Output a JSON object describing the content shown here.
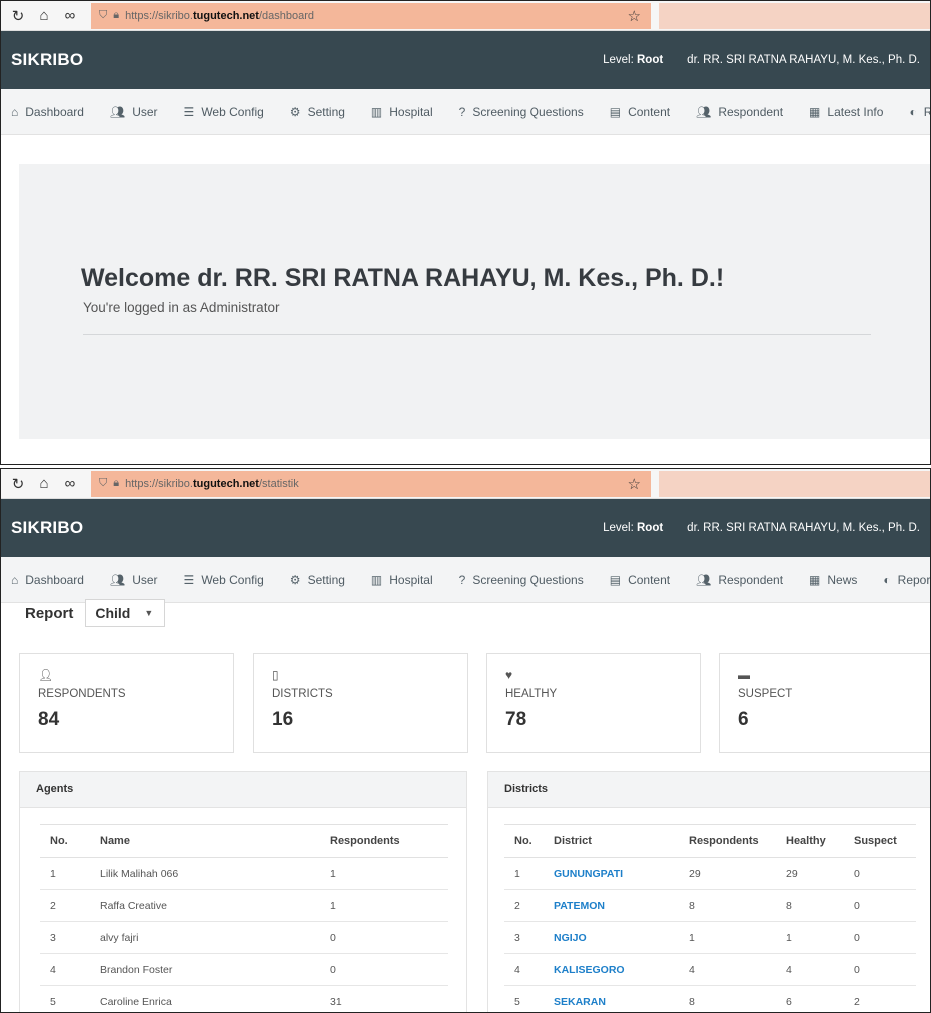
{
  "screen1": {
    "browser": {
      "url_prefix": "https://sikribo.",
      "url_host": "tugutech.net",
      "url_path": "/dashboard"
    },
    "header": {
      "brand": "SIKRIBO",
      "level_label": "Level: ",
      "level_value": "Root",
      "user_name": "dr. RR. SRI RATNA RAHAYU, M. Kes., Ph. D."
    },
    "nav": [
      {
        "icon": "home-icon",
        "label": "Dashboard"
      },
      {
        "icon": "users-icon",
        "label": "User"
      },
      {
        "icon": "database-icon",
        "label": "Web Config"
      },
      {
        "icon": "cogs-icon",
        "label": "Setting"
      },
      {
        "icon": "hospital-icon",
        "label": "Hospital"
      },
      {
        "icon": "question-icon",
        "label": "Screening Questions"
      },
      {
        "icon": "content-icon",
        "label": "Content"
      },
      {
        "icon": "users-icon",
        "label": "Respondent"
      },
      {
        "icon": "newspaper-icon",
        "label": "Latest Info"
      },
      {
        "icon": "dashboard-gauge-icon",
        "label": "Report"
      }
    ],
    "welcome": {
      "title": "Welcome dr. RR. SRI RATNA RAHAYU, M. Kes., Ph. D.!",
      "subtitle": "You're logged in as Administrator"
    }
  },
  "screen2": {
    "browser": {
      "url_prefix": "https://sikribo.",
      "url_host": "tugutech.net",
      "url_path": "/statistik"
    },
    "header": {
      "brand": "SIKRIBO",
      "level_label": "Level: ",
      "level_value": "Root",
      "user_name": "dr. RR. SRI RATNA RAHAYU, M. Kes., Ph. D."
    },
    "nav": [
      {
        "icon": "home-icon",
        "label": "Dashboard"
      },
      {
        "icon": "users-icon",
        "label": "User"
      },
      {
        "icon": "database-icon",
        "label": "Web Config"
      },
      {
        "icon": "cogs-icon",
        "label": "Setting"
      },
      {
        "icon": "hospital-icon",
        "label": "Hospital"
      },
      {
        "icon": "question-icon",
        "label": "Screening Questions"
      },
      {
        "icon": "content-icon",
        "label": "Content"
      },
      {
        "icon": "users-icon",
        "label": "Respondent"
      },
      {
        "icon": "newspaper-icon",
        "label": "News"
      },
      {
        "icon": "dashboard-gauge-icon",
        "label": "Report"
      }
    ],
    "report": {
      "label": "Report",
      "selected": "Child"
    },
    "stats": [
      {
        "icon": "user-check-icon",
        "label": "RESPONDENTS",
        "value": "84"
      },
      {
        "icon": "map-icon",
        "label": "DISTRICTS",
        "value": "16"
      },
      {
        "icon": "heartbeat-icon",
        "label": "HEALTHY",
        "value": "78"
      },
      {
        "icon": "bed-icon",
        "label": "SUSPECT",
        "value": "6"
      }
    ],
    "agents": {
      "title": "Agents",
      "headers": [
        "No.",
        "Name",
        "Respondents"
      ],
      "rows": [
        [
          "1",
          "Lilik Malihah 066",
          "1"
        ],
        [
          "2",
          "Raffa Creative",
          "1"
        ],
        [
          "3",
          "alvy fajri",
          "0"
        ],
        [
          "4",
          "Brandon Foster",
          "0"
        ],
        [
          "5",
          "Caroline Enrica",
          "31"
        ]
      ]
    },
    "districts": {
      "title": "Districts",
      "headers": [
        "No.",
        "District",
        "Respondents",
        "Healthy",
        "Suspect"
      ],
      "rows": [
        [
          "1",
          "GUNUNGPATI",
          "29",
          "29",
          "0"
        ],
        [
          "2",
          "PATEMON",
          "8",
          "8",
          "0"
        ],
        [
          "3",
          "NGIJO",
          "1",
          "1",
          "0"
        ],
        [
          "4",
          "KALISEGORO",
          "4",
          "4",
          "0"
        ],
        [
          "5",
          "SEKARAN",
          "8",
          "6",
          "2"
        ]
      ]
    }
  }
}
